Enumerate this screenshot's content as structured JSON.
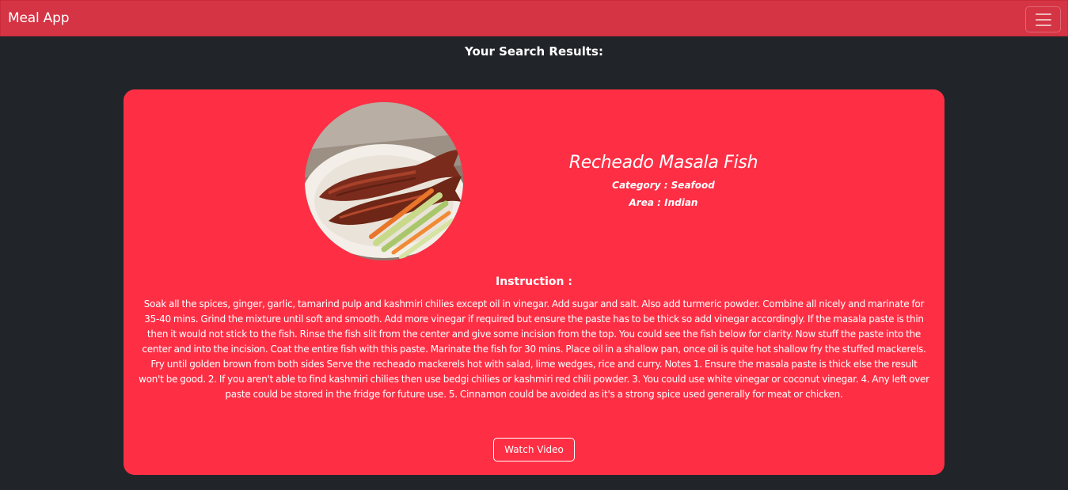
{
  "navbar": {
    "brand": "Meal App",
    "toggler_icon": "hamburger-menu-icon"
  },
  "results": {
    "heading": "Your Search Results:"
  },
  "meal": {
    "title": "Recheado Masala Fish",
    "category_line": "Category : Seafood",
    "area_line": "Area : Indian",
    "image_icon": "fish-dish-photo",
    "instruction_heading": "Instruction :",
    "instructions": "Soak all the spices, ginger, garlic, tamarind pulp and kashmiri chilies except oil in vinegar. Add sugar and salt. Also add turmeric powder. Combine all nicely and marinate for 35-40 mins. Grind the mixture until soft and smooth. Add more vinegar if required but ensure the paste has to be thick so add vinegar accordingly. If the masala paste is thin then it would not stick to the fish. Rinse the fish slit from the center and give some incision from the top. You could see the fish below for clarity. Now stuff the paste into the center and into the incision. Coat the entire fish with this paste. Marinate the fish for 30 mins. Place oil in a shallow pan, once oil is quite hot shallow fry the stuffed mackerels. Fry until golden brown from both sides Serve the recheado mackerels hot with salad, lime wedges, rice and curry. Notes 1. Ensure the masala paste is thick else the result won't be good. 2. If you aren't able to find kashmiri chilies then use bedgi chilies or kashmiri red chili powder. 3. You could use white vinegar or coconut vinegar. 4. Any left over paste could be stored in the fridge for future use. 5. Cinnamon could be avoided as it's a strong spice used generally for meat or chicken.",
    "watch_label": "Watch Video"
  },
  "colors": {
    "page_background": "#212529",
    "navbar": "#d53444",
    "card": "#fe2f45",
    "text": "#ffffff"
  }
}
